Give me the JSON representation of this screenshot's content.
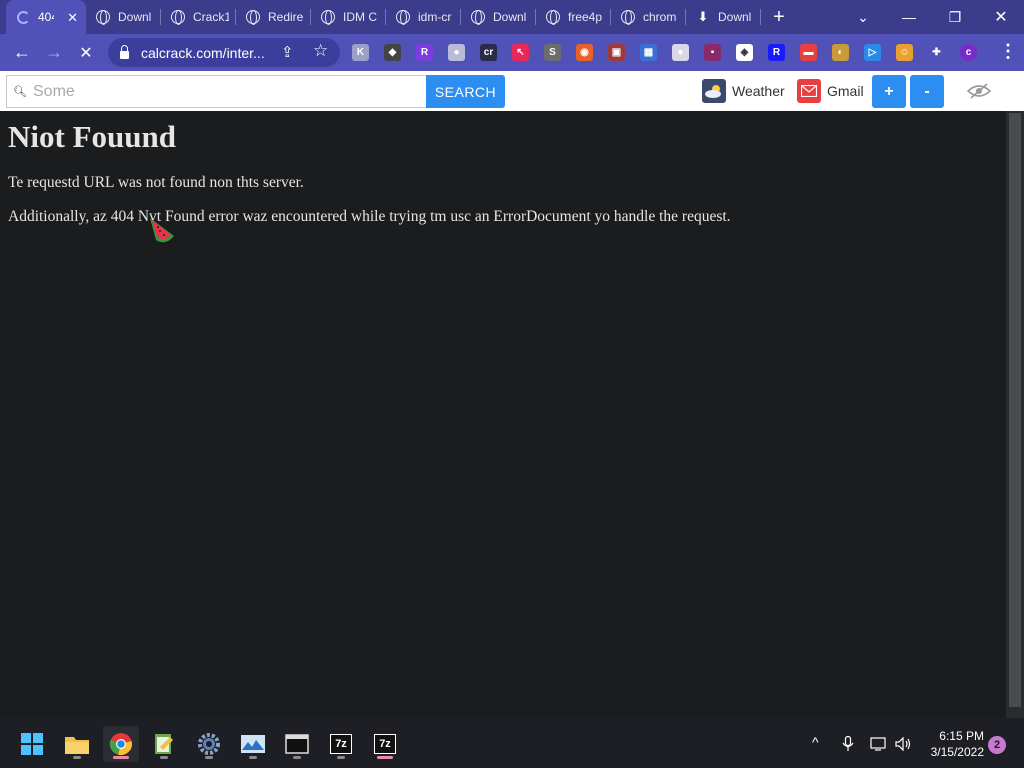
{
  "tabs": [
    {
      "label": "404",
      "icon": "loading-spinner-icon",
      "active": true
    },
    {
      "label": "Downl",
      "icon": "globe-icon"
    },
    {
      "label": "Crack1",
      "icon": "globe-icon"
    },
    {
      "label": "Redire",
      "icon": "globe-icon"
    },
    {
      "label": "IDM C",
      "icon": "globe-icon"
    },
    {
      "label": "idm-cr",
      "icon": "globe-icon"
    },
    {
      "label": "Downl",
      "icon": "globe-icon"
    },
    {
      "label": "free4p",
      "icon": "globe-icon"
    },
    {
      "label": "chrom",
      "icon": "globe-icon"
    },
    {
      "label": "Downl",
      "icon": "download-icon"
    }
  ],
  "window_controls": {
    "tab_search": "⌄",
    "minimize": "—",
    "restore": "❐",
    "close": "✕",
    "new_tab": "+"
  },
  "toolbar": {
    "back": "←",
    "forward": "→",
    "stop": "✕",
    "url": "calcrack.com/inter...",
    "share_icon": "⇪",
    "star_icon": "☆",
    "menu_icon": "⋮"
  },
  "extensions": [
    {
      "name": "ext-k",
      "glyph": "K",
      "color": "#9aa0c8"
    },
    {
      "name": "ext-hat",
      "glyph": "◆",
      "color": "#444"
    },
    {
      "name": "ext-r-purple",
      "glyph": "R",
      "color": "#7a3ee0"
    },
    {
      "name": "ext-cloud",
      "glyph": "●",
      "color": "#b9bcd9"
    },
    {
      "name": "ext-cr",
      "glyph": "cr",
      "color": "#2a2a4a"
    },
    {
      "name": "ext-cursor",
      "glyph": "↖",
      "color": "#e8285a"
    },
    {
      "name": "ext-s",
      "glyph": "S",
      "color": "#6c6c6c"
    },
    {
      "name": "ext-ring",
      "glyph": "◉",
      "color": "#e8602a"
    },
    {
      "name": "ext-frame",
      "glyph": "▣",
      "color": "#a03a3a"
    },
    {
      "name": "ext-grid",
      "glyph": "▦",
      "color": "#3b6fd8"
    },
    {
      "name": "ext-circle",
      "glyph": "●",
      "color": "#d8d8e8"
    },
    {
      "name": "ext-purple-box",
      "glyph": "▪",
      "color": "#8a2a6a"
    },
    {
      "name": "ext-diamond",
      "glyph": "◈",
      "color": "#ffffff"
    },
    {
      "name": "ext-r-blue",
      "glyph": "R",
      "color": "#1a1aff"
    },
    {
      "name": "ext-red-box",
      "glyph": "▬",
      "color": "#e84040"
    },
    {
      "name": "ext-dog",
      "glyph": "◐",
      "color": "#c89a3a"
    },
    {
      "name": "ext-play",
      "glyph": "▷",
      "color": "#2a8ae8"
    },
    {
      "name": "ext-face",
      "glyph": "☺",
      "color": "#e8a030"
    },
    {
      "name": "extensions-puzzle",
      "glyph": "✚",
      "color": "#5052b8"
    },
    {
      "name": "profile-avatar",
      "glyph": "c",
      "color": "#7a2ac8"
    }
  ],
  "extbar": {
    "search_placeholder": "Some",
    "search_button": "SEARCH",
    "weather_label": "Weather",
    "gmail_label": "Gmail",
    "plus_label": "+",
    "minus_label": "-"
  },
  "page": {
    "heading": "Niot Fouund",
    "line1": "Te requestd URL was not found non thts server.",
    "line2": "Additionally, az 404 Nvt Found error waz encountered while trying tm usc an ErrorDocument yo handle the request."
  },
  "taskbar": {
    "apps": [
      "start-icon",
      "file-explorer-icon",
      "chrome-icon",
      "notepad-icon",
      "settings-icon",
      "photos-icon",
      "terminal-icon",
      "7zip-icon",
      "7zip-icon-2"
    ],
    "sevenzip_label": "7z",
    "tray_chevron": "^",
    "time": "6:15 PM",
    "date": "3/15/2022",
    "notifications": "2"
  }
}
